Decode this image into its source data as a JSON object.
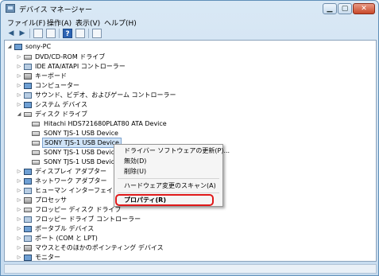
{
  "window": {
    "title": "デバイス マネージャー",
    "min": "▁",
    "max": "▢",
    "close": "✕"
  },
  "menu": [
    "ファイル(F)",
    "操作(A)",
    "表示(V)",
    "ヘルプ(H)"
  ],
  "toolbar": {
    "back": "◀",
    "forward": "▶",
    "help": "?"
  },
  "tree": {
    "root": "sony-PC",
    "items": [
      "DVD/CD-ROM ドライブ",
      "IDE ATA/ATAPI コントローラー",
      "キーボード",
      "コンピューター",
      "サウンド、ビデオ、およびゲーム コントローラー",
      "システム デバイス",
      "ディスク ドライブ",
      "Hitachi HDS721680PLAT80 ATA Device",
      "SONY TJS-1 USB Device",
      "SONY TJS-1 USB Device",
      "SONY TJS-1 USB Device",
      "SONY TJS-1 USB Device",
      "ディスプレイ アダプター",
      "ネットワーク アダプター",
      "ヒューマン インターフェイス",
      "プロセッサ",
      "フロッピー ディスク ドライブ",
      "フロッピー ドライブ コントローラー",
      "ポータブル デバイス",
      "ポート (COM と LPT)",
      "マウスとそのほかのポインティング デバイス",
      "モニター"
    ],
    "expanded": "◢",
    "collapsed": "▷"
  },
  "context_menu": {
    "update_driver": "ドライバー ソフトウェアの更新(P)...",
    "disable": "無効(D)",
    "uninstall": "削除(U)",
    "scan": "ハードウェア変更のスキャン(A)",
    "properties": "プロパティ(R)"
  },
  "colors": {
    "highlight_border": "#e0191a",
    "selection": "#cfe3f7"
  }
}
